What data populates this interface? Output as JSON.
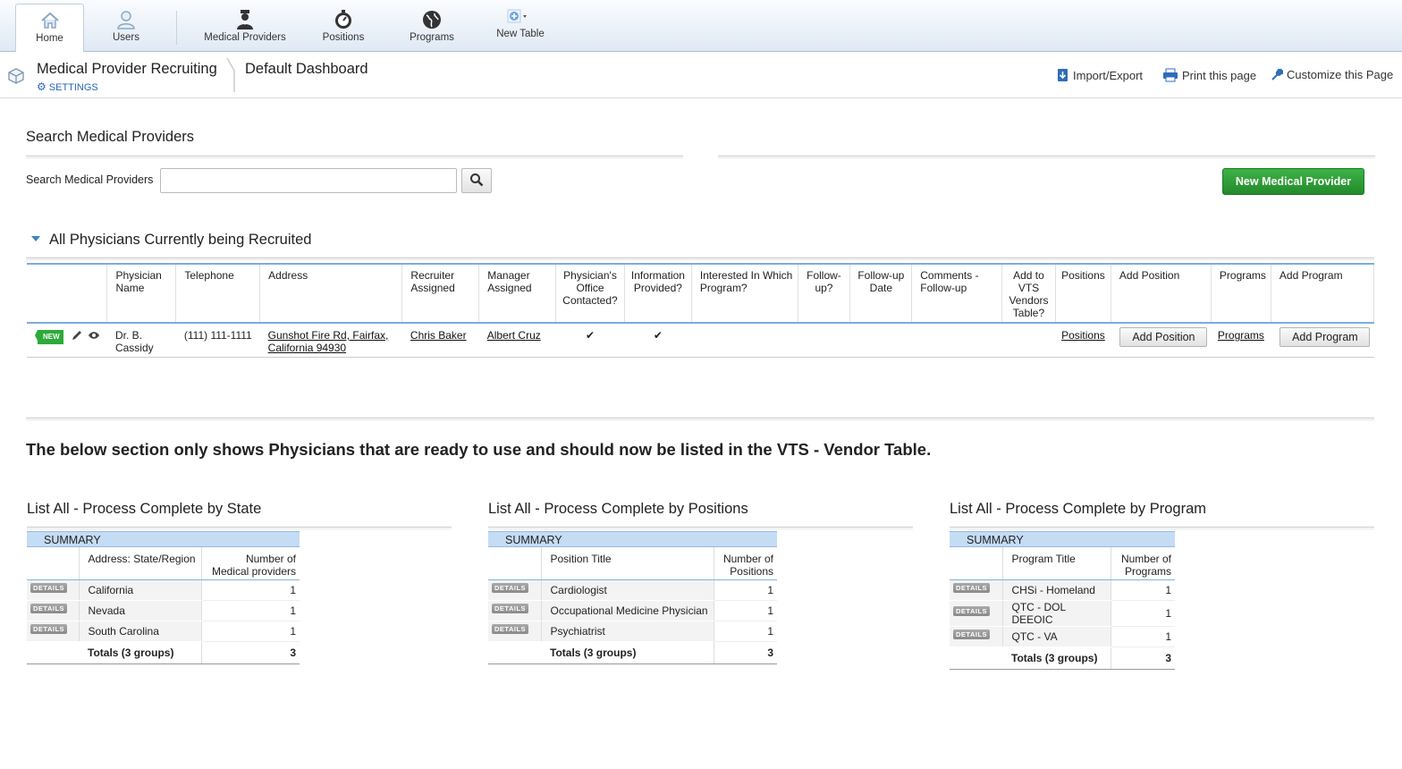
{
  "nav": {
    "tabs": [
      {
        "label": "Home",
        "icon": "home-icon",
        "active": true
      },
      {
        "label": "Users",
        "icon": "user-icon"
      },
      {
        "label": "Medical Providers",
        "icon": "doctor-icon"
      },
      {
        "label": "Positions",
        "icon": "stopwatch-icon"
      },
      {
        "label": "Programs",
        "icon": "globe-icon"
      },
      {
        "label": "New Table",
        "icon": "add-table-icon"
      }
    ]
  },
  "header": {
    "app_title": "Medical Provider Recruiting",
    "settings_label": "SETTINGS",
    "dashboard_title": "Default Dashboard",
    "links": {
      "import_export": "Import/Export",
      "print": "Print this page",
      "customize": "Customize this Page"
    }
  },
  "search": {
    "title": "Search Medical Providers",
    "label": "Search Medical Providers",
    "value": "",
    "placeholder": "",
    "new_button": "New Medical Provider"
  },
  "recruited": {
    "title": "All Physicians Currently being Recruited",
    "columns": [
      "Physician Name",
      "Telephone",
      "Address",
      "Recruiter Assigned",
      "Manager Assigned",
      "Physician's Office Contacted?",
      "Information Provided?",
      "Interested In Which Program?",
      "Follow-up?",
      "Follow-up Date",
      "Comments - Follow-up",
      "Add to VTS Vendors Table?",
      "Positions",
      "Add Position",
      "Programs",
      "Add Program"
    ],
    "rows": [
      {
        "badge": "NEW",
        "name": "Dr. B. Cassidy",
        "telephone": "(111) 111-1111",
        "address": "Gunshot Fire Rd, Fairfax, California 94930",
        "recruiter": "Chris Baker",
        "manager": "Albert Cruz",
        "office_contacted": "✔",
        "info_provided": "✔",
        "interested_program": "",
        "follow_up": "",
        "follow_up_date": "",
        "comments": "",
        "add_to_vts": "",
        "positions_link": "Positions",
        "add_position": "Add  Position",
        "programs_link": "Programs",
        "add_program": "Add  Program"
      }
    ]
  },
  "notice": "The below section only shows Physicians that are ready to use and should now be listed in the VTS - Vendor Table.",
  "summaries": [
    {
      "title": "List All - Process Complete by State",
      "summary_label": "SUMMARY",
      "col1": "Address: State/Region",
      "col2": "Number of Medical providers",
      "rows": [
        {
          "label": "California",
          "value": "1"
        },
        {
          "label": "Nevada",
          "value": "1"
        },
        {
          "label": "South Carolina",
          "value": "1"
        }
      ],
      "details_label": "DETAILS",
      "total_label": "Totals (3 groups)",
      "total_value": "3"
    },
    {
      "title": "List All - Process Complete by Positions",
      "summary_label": "SUMMARY",
      "col1": "Position Title",
      "col2": "Number of Positions",
      "rows": [
        {
          "label": "Cardiologist",
          "value": "1"
        },
        {
          "label": "Occupational Medicine Physician",
          "value": "1"
        },
        {
          "label": "Psychiatrist",
          "value": "1"
        }
      ],
      "details_label": "DETAILS",
      "total_label": "Totals (3 groups)",
      "total_value": "3"
    },
    {
      "title": "List All - Process Complete by Program",
      "summary_label": "SUMMARY",
      "col1": "Program Title",
      "col2": "Number of Programs",
      "rows": [
        {
          "label": "CHSi - Homeland",
          "value": "1"
        },
        {
          "label": "QTC - DOL DEEOIC",
          "value": "1"
        },
        {
          "label": "QTC - VA",
          "value": "1"
        }
      ],
      "details_label": "DETAILS",
      "total_label": "Totals (3 groups)",
      "total_value": "3"
    }
  ],
  "colors": {
    "accent": "#2b66b5",
    "new_button": "#2d9e37",
    "table_rule": "#7aaee0",
    "summary_header": "#c5dcf5"
  }
}
